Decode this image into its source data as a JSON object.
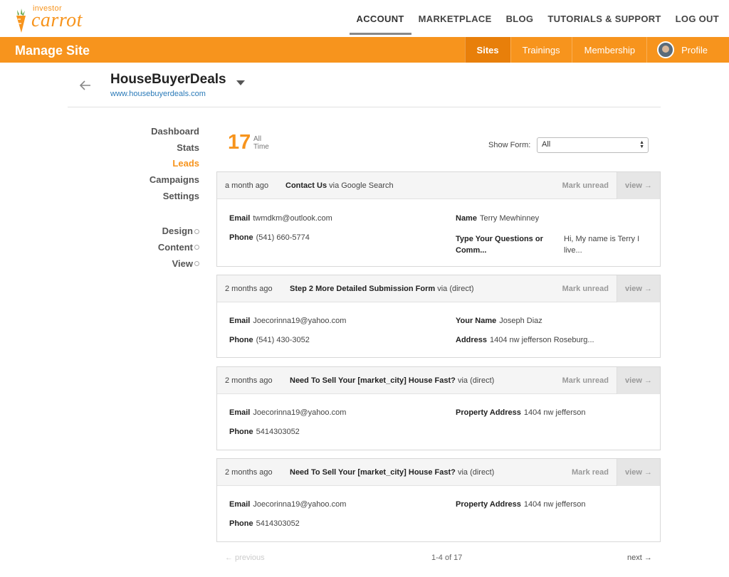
{
  "logo": {
    "small": "investor",
    "big": "carrot"
  },
  "topnav": [
    "ACCOUNT",
    "MARKETPLACE",
    "BLOG",
    "TUTORIALS & SUPPORT",
    "LOG OUT"
  ],
  "header": {
    "title": "Manage Site",
    "subnav": [
      "Sites",
      "Trainings",
      "Membership"
    ],
    "profile_label": "Profile"
  },
  "site": {
    "name": "HouseBuyerDeals",
    "url": "www.housebuyerdeals.com"
  },
  "leftmenu": {
    "primary": [
      "Dashboard",
      "Stats",
      "Leads",
      "Campaigns",
      "Settings"
    ],
    "secondary": [
      "Design",
      "Content",
      "View"
    ]
  },
  "leads": {
    "count": "17",
    "count_label_1": "All",
    "count_label_2": "Time",
    "show_form_label": "Show Form:",
    "show_form_value": "All",
    "items": [
      {
        "when": "a month ago",
        "form_name": "Contact Us",
        "via": "via Google Search",
        "mark": "Mark unread",
        "view": "view →",
        "fields": [
          {
            "label": "Email",
            "value": "twmdkm@outlook.com"
          },
          {
            "label": "Phone",
            "value": "(541) 660-5774"
          },
          {
            "label": "Name",
            "value": "Terry Mewhinney"
          },
          {
            "label": "Type Your Questions or Comm...",
            "value": "Hi, My name is Terry I live..."
          }
        ]
      },
      {
        "when": "2 months ago",
        "form_name": "Step 2 More Detailed Submission Form",
        "via": "via (direct)",
        "mark": "Mark unread",
        "view": "view →",
        "fields": [
          {
            "label": "Email",
            "value": "Joecorinna19@yahoo.com"
          },
          {
            "label": "Phone",
            "value": "(541) 430-3052"
          },
          {
            "label": "Your Name",
            "value": "Joseph Diaz"
          },
          {
            "label": "Address",
            "value": "1404 nw jefferson Roseburg..."
          }
        ]
      },
      {
        "when": "2 months ago",
        "form_name": "Need To Sell Your [market_city] House Fast?",
        "via": "via (direct)",
        "mark": "Mark unread",
        "view": "view →",
        "fields": [
          {
            "label": "Email",
            "value": "Joecorinna19@yahoo.com"
          },
          {
            "label": "Phone",
            "value": "5414303052"
          },
          {
            "label": "Property Address",
            "value": "1404 nw jefferson"
          }
        ]
      },
      {
        "when": "2 months ago",
        "form_name": "Need To Sell Your [market_city] House Fast?",
        "via": "via (direct)",
        "mark": "Mark read",
        "view": "view →",
        "fields": [
          {
            "label": "Email",
            "value": "Joecorinna19@yahoo.com"
          },
          {
            "label": "Phone",
            "value": "5414303052"
          },
          {
            "label": "Property Address",
            "value": "1404 nw jefferson"
          }
        ]
      }
    ]
  },
  "pagination": {
    "prev": "← previous",
    "info": "1-4 of 17",
    "next": "next →"
  },
  "colors": {
    "accent": "#f7941d",
    "accent_dark": "#e87f0a",
    "link": "#2a7ab8"
  }
}
